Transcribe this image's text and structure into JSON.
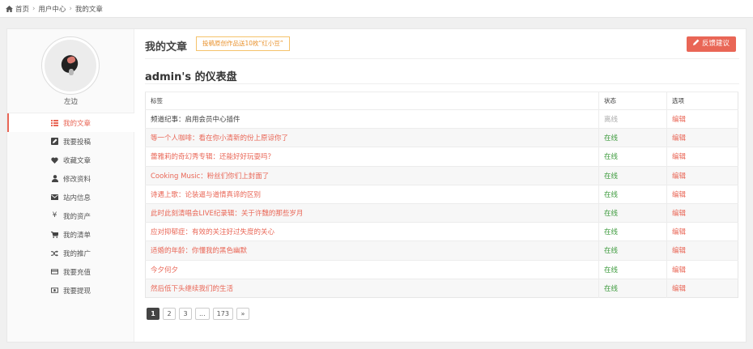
{
  "breadcrumb": {
    "home": "首页",
    "user_center": "用户中心",
    "current": "我的文章"
  },
  "sidebar": {
    "username": "左边",
    "items": [
      {
        "label": "我的文章",
        "icon": "list-icon",
        "active": true
      },
      {
        "label": "我要投稿",
        "icon": "edit-icon",
        "active": false
      },
      {
        "label": "收藏文章",
        "icon": "heart-icon",
        "active": false
      },
      {
        "label": "修改资料",
        "icon": "user-icon",
        "active": false
      },
      {
        "label": "站内信息",
        "icon": "envelope-icon",
        "active": false
      },
      {
        "label": "我的资产",
        "icon": "yen-icon",
        "active": false
      },
      {
        "label": "我的清单",
        "icon": "cart-icon",
        "active": false
      },
      {
        "label": "我的推广",
        "icon": "shuffle-icon",
        "active": false
      },
      {
        "label": "我要充值",
        "icon": "credit-card-icon",
        "active": false
      },
      {
        "label": "我要提现",
        "icon": "money-icon",
        "active": false
      }
    ]
  },
  "header": {
    "title": "我的文章",
    "promo": "投稿原创作品送10枚“红小豆”",
    "feedback_label": "反馈建议"
  },
  "dashboard": {
    "title": "admin's 的仪表盘"
  },
  "table": {
    "columns": [
      "标签",
      "状态",
      "选项"
    ],
    "rows": [
      {
        "title": "频道纪事：启用会员中心插件",
        "status": "离线",
        "online": false,
        "action": "编辑"
      },
      {
        "title": "等一个人咖啡：看在你小清新的份上原谅你了",
        "status": "在线",
        "online": true,
        "action": "编辑"
      },
      {
        "title": "蕾雅莉的奇幻秀专辑：还能好好玩耍吗？",
        "status": "在线",
        "online": true,
        "action": "编辑"
      },
      {
        "title": "Cooking Music：粉丝们你们上封面了",
        "status": "在线",
        "online": true,
        "action": "编辑"
      },
      {
        "title": "诗遇上歌：论装逼与道情真谛的区别",
        "status": "在线",
        "online": true,
        "action": "编辑"
      },
      {
        "title": "此时此刻清唱会LIVE纪录辑：关于许魏的那些岁月",
        "status": "在线",
        "online": true,
        "action": "编辑"
      },
      {
        "title": "应对抑郁症：有效的关注好过失度的关心",
        "status": "在线",
        "online": true,
        "action": "编辑"
      },
      {
        "title": "适婚的年龄：你懂我的黑色幽默",
        "status": "在线",
        "online": true,
        "action": "编辑"
      },
      {
        "title": "今夕何夕",
        "status": "在线",
        "online": true,
        "action": "编辑"
      },
      {
        "title": "然后低下头继续我们的生活",
        "status": "在线",
        "online": true,
        "action": "编辑"
      }
    ]
  },
  "pagination": {
    "pages": [
      "1",
      "2",
      "3",
      "...",
      "173",
      "»"
    ],
    "current": "1"
  },
  "colors": {
    "accent": "#e96656",
    "online": "#3c9a3c",
    "offline": "#aaaaaa",
    "promo_border": "#f5c26b",
    "promo_text": "#e9922d"
  }
}
